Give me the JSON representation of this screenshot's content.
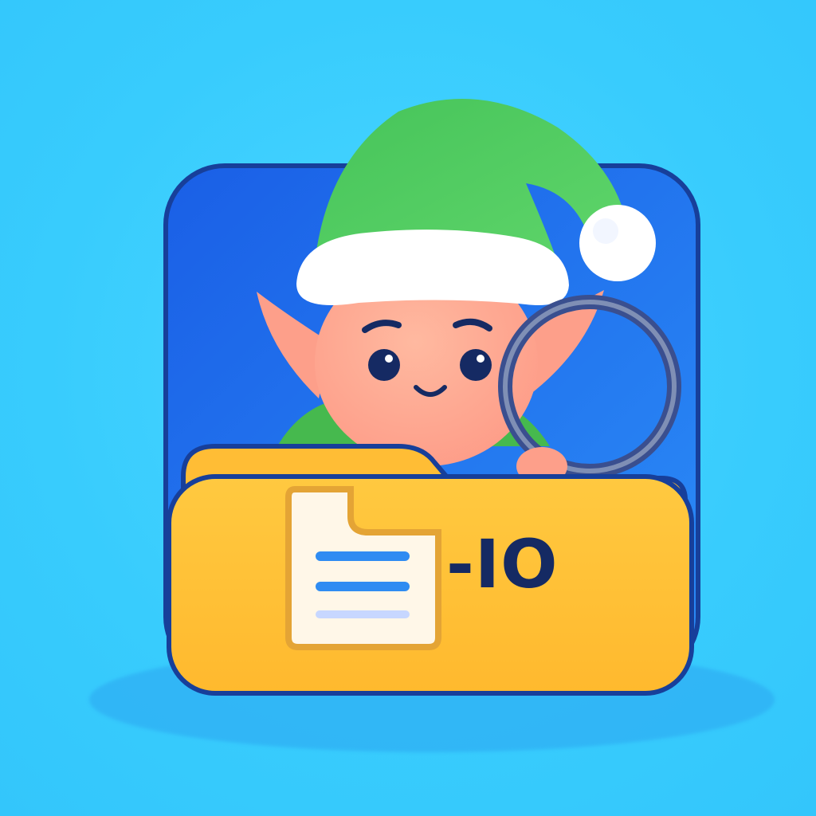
{
  "logo": {
    "text": "-IO"
  },
  "colors": {
    "background": "#38ccfd",
    "tile": "#1f6ff0",
    "folder": "#ffc43a",
    "hat": "#4fcf63",
    "hat_trim": "#ffffff",
    "skin": "#ffad95",
    "ink": "#152a63",
    "doc_lines": "#2f8cf2"
  },
  "icons": {
    "character": "elf-icon",
    "folder": "folder-icon",
    "document": "document-icon",
    "lens": "magnifier-ring-icon"
  }
}
